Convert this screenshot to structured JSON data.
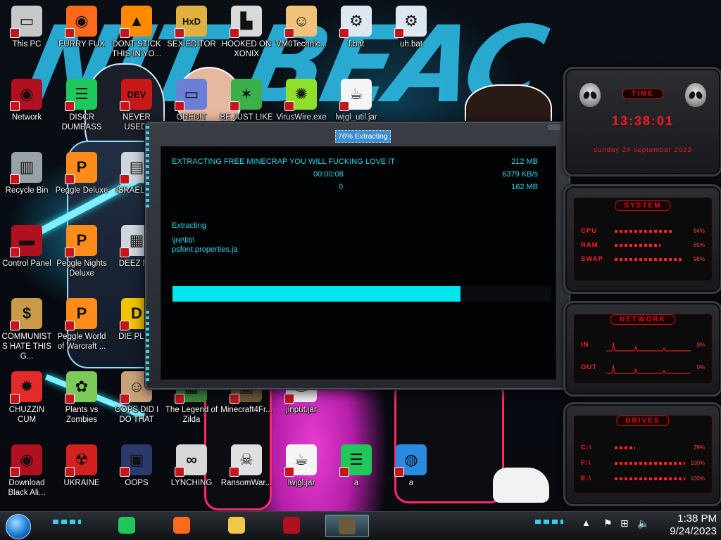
{
  "wallpaper": {
    "graffiti_text": "NIT BEAC"
  },
  "desktop_icons": [
    {
      "label": "This PC",
      "icon": "computer-icon",
      "color": "#c8c8c8",
      "glyph": "▭"
    },
    {
      "label": "FURRY FUX",
      "icon": "firefox-icon",
      "color": "#ff6a1a",
      "glyph": "◉"
    },
    {
      "label": "DONT STICK THIS IN YO...",
      "icon": "traffic-cone-icon",
      "color": "#ff8a00",
      "glyph": "▲"
    },
    {
      "label": "SEX EDITOR",
      "icon": "hex-editor-icon",
      "color": "#e0b040",
      "glyph": "HxD"
    },
    {
      "label": "HOOKED ON XONIX",
      "icon": "xonix-icon",
      "color": "#d9d9d9",
      "glyph": "▙"
    },
    {
      "label": "VM0Technic...",
      "icon": "doctor-icon",
      "color": "#f2c27a",
      "glyph": "☺"
    },
    {
      "label": "f.bat",
      "icon": "gear-file-icon",
      "color": "#dfe8f2",
      "glyph": "⚙"
    },
    {
      "label": "uh.bat",
      "icon": "gear-file-icon",
      "color": "#dfe8f2",
      "glyph": "⚙"
    },
    {
      "label": "Network",
      "icon": "alienware-orb-icon",
      "color": "#b01020",
      "glyph": "◉"
    },
    {
      "label": "DISCR DUMBASS",
      "icon": "chat-icon",
      "color": "#1ec85a",
      "glyph": "☰"
    },
    {
      "label": "NEVER USED!",
      "icon": "devcpp-icon",
      "color": "#c81818",
      "glyph": "DEV"
    },
    {
      "label": "CREDIT CARD",
      "icon": "credit-card-icon",
      "color": "#6a7fd6",
      "glyph": "▭"
    },
    {
      "label": "BE JUST LIKE",
      "icon": "santa-icon",
      "color": "#3bb04a",
      "glyph": "✶"
    },
    {
      "label": "VirusWire.exe",
      "icon": "lime-icon",
      "color": "#8ee02a",
      "glyph": "✺"
    },
    {
      "label": "lwjgl_util.jar",
      "icon": "java-icon",
      "color": "#f5f5f5",
      "glyph": "☕"
    },
    {
      "label": "Recycle Bin",
      "icon": "recycle-bin-icon",
      "color": "#9aa0a8",
      "glyph": "▥"
    },
    {
      "label": "Peggle Deluxe",
      "icon": "peggle-icon",
      "color": "#ff8c1a",
      "glyph": "P"
    },
    {
      "label": "ISRAEL SP",
      "icon": "folder-icon",
      "color": "#cfd6de",
      "glyph": "▤"
    },
    {
      "label": "Control Panel",
      "icon": "control-panel-icon",
      "color": "#b01020",
      "glyph": "▬"
    },
    {
      "label": "Peggle Nights Deluxe",
      "icon": "peggle-icon",
      "color": "#ff8c1a",
      "glyph": "P"
    },
    {
      "label": "DEEZ NU",
      "icon": "stacked-windows-icon",
      "color": "#cfd6de",
      "glyph": "▦"
    },
    {
      "label": "COMMUNISTS HATE THIS G...",
      "icon": "money-bag-icon",
      "color": "#c99a4a",
      "glyph": "$"
    },
    {
      "label": "Peggle World of Warcraft ...",
      "icon": "peggle-icon",
      "color": "#ff8c1a",
      "glyph": "P"
    },
    {
      "label": "DIE PLEA",
      "icon": "die-icon",
      "color": "#f2c400",
      "glyph": "D"
    },
    {
      "label": "CHUZZIN CUM",
      "icon": "chuzzle-icon",
      "color": "#e52a2a",
      "glyph": "✹"
    },
    {
      "label": "Plants vs Zombies",
      "icon": "plants-icon",
      "color": "#7dc95a",
      "glyph": "✿"
    },
    {
      "label": "OOPS DID I DO THAT",
      "icon": "portrait-icon",
      "color": "#c9a27a",
      "glyph": "☺"
    },
    {
      "label": "The Legend of Zilda",
      "icon": "zelda-icon",
      "color": "#3a8a3a",
      "glyph": "▦"
    },
    {
      "label": "Minecraft4Fr...",
      "icon": "minecraft-icon",
      "color": "#6b5b3a",
      "glyph": "▣"
    },
    {
      "label": "jinput.jar",
      "icon": "java-icon",
      "color": "#f5f5f5",
      "glyph": "☕"
    },
    {
      "label": "Download Black Ali...",
      "icon": "alienware-orb-icon",
      "color": "#b01020",
      "glyph": "◉"
    },
    {
      "label": "UKRAINE",
      "icon": "radiation-icon",
      "color": "#d42020",
      "glyph": "☢"
    },
    {
      "label": "OOPS",
      "icon": "terminal-icon",
      "color": "#2a3a6a",
      "glyph": "▣"
    },
    {
      "label": "LYNCHING",
      "icon": "rope-icon",
      "color": "#d8d8d8",
      "glyph": "∞"
    },
    {
      "label": "RansomWar...",
      "icon": "skull-icon",
      "color": "#e0e0e0",
      "glyph": "☠"
    },
    {
      "label": "lwjgl.jar",
      "icon": "java-icon",
      "color": "#f5f5f5",
      "glyph": "☕"
    },
    {
      "label": "a",
      "icon": "chat-icon",
      "color": "#1ec85a",
      "glyph": "☰"
    },
    {
      "label": "a",
      "icon": "globe-icon",
      "color": "#2a8ae0",
      "glyph": "◍"
    }
  ],
  "extract_window": {
    "title": "76% Extracting",
    "message": "EXTRACTING FREE MINECRAP YOU WILL FUCKING LOVE IT",
    "elapsed": "00:00:08",
    "remaining": "0",
    "total_size": "212 MB",
    "speed": "6379 KB/s",
    "processed": "162 MB",
    "status": "Extracting",
    "path": "\\jre\\lib\\",
    "file": "psfont.properties.ja",
    "progress_percent": 76
  },
  "gadgets": {
    "time": {
      "title": "TIME",
      "clock": "13:38:01",
      "date": "sunday 24 september 2023"
    },
    "system": {
      "title": "SYSTEM",
      "rows": [
        {
          "label": "CPU",
          "value": "84%"
        },
        {
          "label": "RAM",
          "value": "65%"
        },
        {
          "label": "SWAP",
          "value": "98%"
        }
      ]
    },
    "network": {
      "title": "NETWORK",
      "rows": [
        {
          "label": "IN",
          "value": "0%"
        },
        {
          "label": "OUT",
          "value": "0%"
        }
      ]
    },
    "drives": {
      "title": "DRIVES",
      "rows": [
        {
          "label": "C:\\",
          "value": "29%"
        },
        {
          "label": "F:\\",
          "value": "100%"
        },
        {
          "label": "E:\\",
          "value": "100%"
        }
      ]
    }
  },
  "taskbar": {
    "apps": [
      {
        "name": "chat-app",
        "icon": "chat-icon",
        "color": "#1ec85a"
      },
      {
        "name": "firefox",
        "icon": "firefox-icon",
        "color": "#ff6a1a"
      },
      {
        "name": "file-explorer",
        "icon": "folder-icon",
        "color": "#f2c84a"
      },
      {
        "name": "control-panel",
        "icon": "control-panel-icon",
        "color": "#b01020"
      },
      {
        "name": "minecraft",
        "icon": "minecraft-icon",
        "color": "#6b5b3a"
      }
    ],
    "clock_time": "1:38 PM",
    "clock_date": "9/24/2023"
  },
  "colors": {
    "accent": "#26d9ea",
    "gadget_red": "#ff1a1a",
    "progress": "#00e5ee"
  }
}
